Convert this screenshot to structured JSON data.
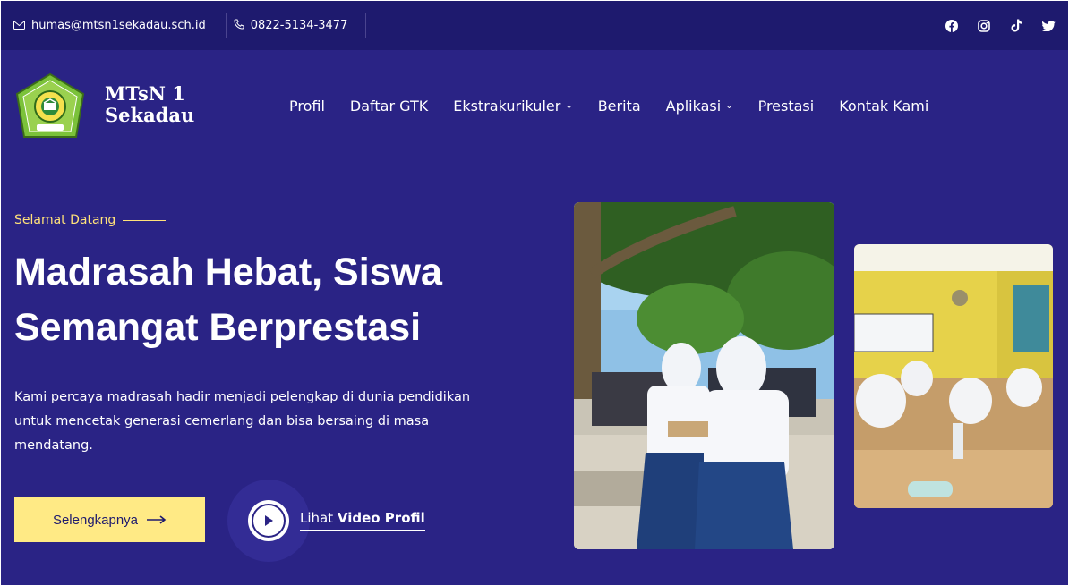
{
  "topbar": {
    "email": "humas@mtsn1sekadau.sch.id",
    "phone": "0822-5134-3477",
    "socials": [
      "facebook-icon",
      "instagram-icon",
      "tiktok-icon",
      "twitter-icon"
    ]
  },
  "brand": {
    "line1": "MTsN 1",
    "line2": "Sekadau",
    "logo_text": "SEKADAU"
  },
  "nav": {
    "items": [
      {
        "label": "Profil",
        "dropdown": false
      },
      {
        "label": "Daftar GTK",
        "dropdown": false
      },
      {
        "label": "Ekstrakurikuler",
        "dropdown": true
      },
      {
        "label": "Berita",
        "dropdown": false
      },
      {
        "label": "Aplikasi",
        "dropdown": true
      },
      {
        "label": "Prestasi",
        "dropdown": false
      },
      {
        "label": "Kontak Kami",
        "dropdown": false
      }
    ]
  },
  "hero": {
    "eyebrow": "Selamat Datang",
    "title_line1": "Madrasah Hebat, Siswa",
    "title_line2": "Semangat Berprestasi",
    "lead_line1": "Kami percaya madrasah hadir menjadi pelengkap di dunia pendidikan",
    "lead_line2": "untuk mencetak generasi cemerlang dan bisa bersaing di masa",
    "lead_line3": "mendatang.",
    "cta_label": "Selengkapnya",
    "video_prefix": "Lihat ",
    "video_label": "Video Profil"
  },
  "colors": {
    "background": "#2a2385",
    "topbar": "#1e1a6e",
    "accent": "#ffea85",
    "eyebrow": "#ffe27a"
  }
}
